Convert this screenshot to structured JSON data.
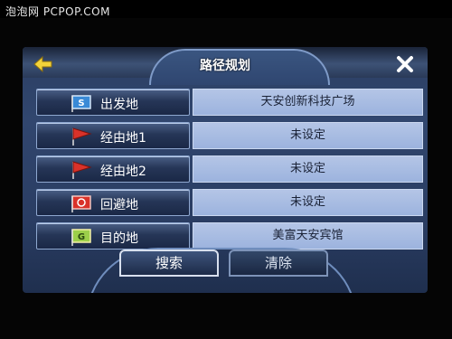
{
  "watermark": "泡泡网 PCPOP.COM",
  "header": {
    "title": "路径规划",
    "back_icon": "back-arrow-icon",
    "close_icon": "close-icon"
  },
  "rows": [
    {
      "label": "出发地",
      "value": "天安创新科技广场",
      "icon": "start-flag-icon"
    },
    {
      "label": "经由地1",
      "value": "未设定",
      "icon": "waypoint-flag-icon"
    },
    {
      "label": "经由地2",
      "value": "未设定",
      "icon": "waypoint-flag-icon"
    },
    {
      "label": "回避地",
      "value": "未设定",
      "icon": "avoid-flag-icon"
    },
    {
      "label": "目的地",
      "value": "美富天安宾馆",
      "icon": "destination-flag-icon"
    }
  ],
  "actions": {
    "search_label": "搜索",
    "clear_label": "清除"
  },
  "colors": {
    "background": "#2b3f63",
    "field": "#a8bbe2",
    "accent_yellow": "#f3d33a",
    "flag_red": "#d9322a",
    "flag_blue": "#3a8ad6",
    "flag_green": "#9ccf4a"
  }
}
